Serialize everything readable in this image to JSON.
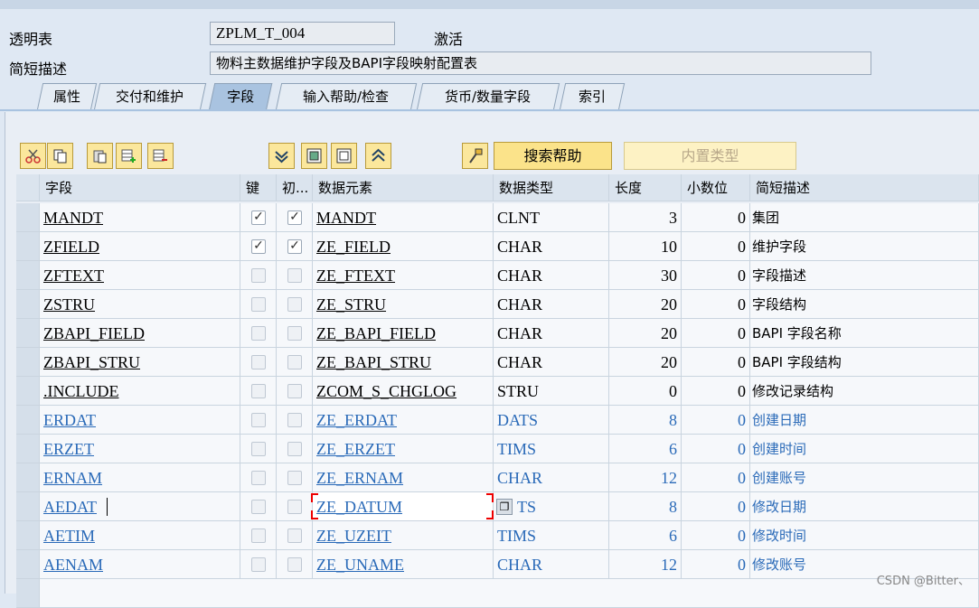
{
  "header": {
    "table_label": "透明表",
    "table_name": "ZPLM_T_004",
    "status": "激活",
    "desc_label": "简短描述",
    "desc_value": "物料主数据维护字段及BAPI字段映射配置表"
  },
  "tabs": [
    {
      "label": "属性"
    },
    {
      "label": "交付和维护"
    },
    {
      "label": "字段"
    },
    {
      "label": "输入帮助/检查"
    },
    {
      "label": "货币/数量字段"
    },
    {
      "label": "索引"
    }
  ],
  "toolbar": {
    "search_help": "搜索帮助",
    "builtin_type": "内置类型"
  },
  "columns": {
    "field": "字段",
    "key": "键",
    "init": "初...",
    "data_element": "数据元素",
    "data_type": "数据类型",
    "length": "长度",
    "decimals": "小数位",
    "short_desc": "简短描述"
  },
  "rows": [
    {
      "field": "MANDT",
      "key": true,
      "init": true,
      "element": "MANDT",
      "type": "CLNT",
      "length": "3",
      "dec": "0",
      "desc": "集团"
    },
    {
      "field": "ZFIELD",
      "key": true,
      "init": true,
      "element": "ZE_FIELD",
      "type": "CHAR",
      "length": "10",
      "dec": "0",
      "desc": "维护字段"
    },
    {
      "field": "ZFTEXT",
      "key": false,
      "init": false,
      "element": "ZE_FTEXT",
      "type": "CHAR",
      "length": "30",
      "dec": "0",
      "desc": "字段描述"
    },
    {
      "field": "ZSTRU",
      "key": false,
      "init": false,
      "element": "ZE_STRU",
      "type": "CHAR",
      "length": "20",
      "dec": "0",
      "desc": "字段结构"
    },
    {
      "field": "ZBAPI_FIELD",
      "key": false,
      "init": false,
      "element": "ZE_BAPI_FIELD",
      "type": "CHAR",
      "length": "20",
      "dec": "0",
      "desc": "BAPI 字段名称"
    },
    {
      "field": "ZBAPI_STRU",
      "key": false,
      "init": false,
      "element": "ZE_BAPI_STRU",
      "type": "CHAR",
      "length": "20",
      "dec": "0",
      "desc": "BAPI 字段结构"
    },
    {
      "field": ".INCLUDE",
      "key": false,
      "init": false,
      "element": "ZCOM_S_CHGLOG",
      "type": "STRU",
      "length": "0",
      "dec": "0",
      "desc": "修改记录结构"
    },
    {
      "field": "ERDAT",
      "key": false,
      "init": false,
      "element": "ZE_ERDAT",
      "type": "DATS",
      "length": "8",
      "dec": "0",
      "desc": "创建日期"
    },
    {
      "field": "ERZET",
      "key": false,
      "init": false,
      "element": "ZE_ERZET",
      "type": "TIMS",
      "length": "6",
      "dec": "0",
      "desc": "创建时间"
    },
    {
      "field": "ERNAM",
      "key": false,
      "init": false,
      "element": "ZE_ERNAM",
      "type": "CHAR",
      "length": "12",
      "dec": "0",
      "desc": "创建账号"
    },
    {
      "field": "AEDAT",
      "key": false,
      "init": false,
      "element": "ZE_DATUM",
      "type": "TS",
      "length": "8",
      "dec": "0",
      "desc": "修改日期"
    },
    {
      "field": "AETIM",
      "key": false,
      "init": false,
      "element": "ZE_UZEIT",
      "type": "TIMS",
      "length": "6",
      "dec": "0",
      "desc": "修改时间"
    },
    {
      "field": "AENAM",
      "key": false,
      "init": false,
      "element": "ZE_UNAME",
      "type": "CHAR",
      "length": "12",
      "dec": "0",
      "desc": "修改账号"
    }
  ],
  "watermark": "CSDN @Bitter、"
}
